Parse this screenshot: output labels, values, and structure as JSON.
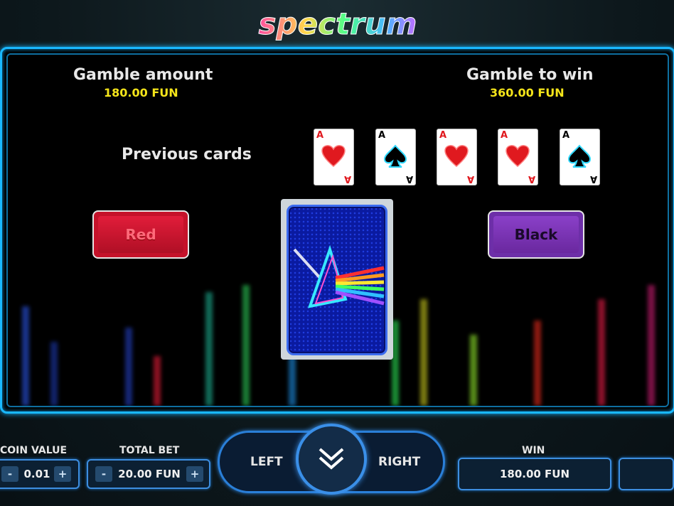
{
  "logo": {
    "text": "spectrum"
  },
  "gamble": {
    "amount_label": "Gamble amount",
    "amount_value": "180.00 FUN",
    "towin_label": "Gamble to win",
    "towin_value": "360.00 FUN",
    "previous_label": "Previous cards"
  },
  "previous_cards": [
    {
      "rank": "A",
      "suit": "hearts",
      "color": "#e0191f"
    },
    {
      "rank": "A",
      "suit": "spades",
      "color": "#000000"
    },
    {
      "rank": "A",
      "suit": "hearts",
      "color": "#e0191f"
    },
    {
      "rank": "A",
      "suit": "hearts",
      "color": "#e0191f"
    },
    {
      "rank": "A",
      "suit": "spades",
      "color": "#000000"
    }
  ],
  "buttons": {
    "red": "Red",
    "black": "Black"
  },
  "footer": {
    "coin_value_label": "COIN VALUE",
    "coin_value": "0.01",
    "total_bet_label": "TOTAL BET",
    "total_bet": "20.00 FUN",
    "minus": "-",
    "plus": "+",
    "left": "LEFT",
    "right": "RIGHT",
    "win_label": "WIN",
    "win_value": "180.00 FUN"
  },
  "colors": {
    "accent": "#19b8ff",
    "yellow": "#f5e51a",
    "red_button": "#c5122a",
    "black_button": "#6d2fa8"
  }
}
